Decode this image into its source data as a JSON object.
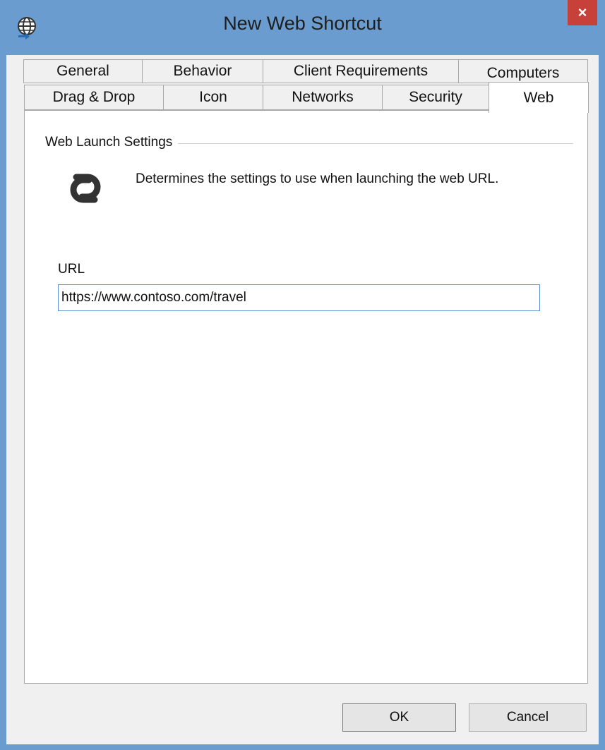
{
  "window": {
    "title": "New Web Shortcut",
    "close_label": "×",
    "title_bar_color": "#6a9ccf",
    "close_button_color": "#c7413a"
  },
  "tabs": {
    "row_back": [
      "General",
      "Behavior",
      "Client Requirements",
      "Computers"
    ],
    "row_front": [
      "Drag & Drop",
      "Icon",
      "Networks",
      "Security",
      "Web"
    ],
    "active": "Web"
  },
  "web_panel": {
    "group_title": "Web Launch Settings",
    "description": "Determines the settings to use when launching the web URL.",
    "icon": "link-icon",
    "url_label": "URL",
    "url_value": "https://www.contoso.com/travel"
  },
  "buttons": {
    "ok_label": "OK",
    "cancel_label": "Cancel"
  }
}
